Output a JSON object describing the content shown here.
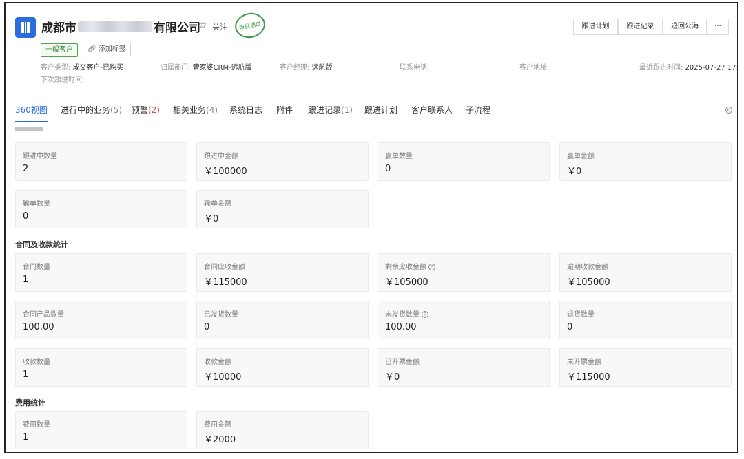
{
  "header": {
    "company_prefix": "成都市",
    "company_suffix": "有限公司",
    "follow_label": "关注",
    "stamp_text": "审批通过",
    "tag_type": "一般客户",
    "add_tag_label": "添加标签",
    "meta": {
      "customer_type_label": "客户类型:",
      "customer_type_value": "成交客户-已购买",
      "department_label": "归属部门:",
      "department_value": "管家婆CRM-远航版",
      "manager_label": "客户经理:",
      "manager_value": "远航版",
      "phone_label": "联系电话:",
      "address_label": "客户地址:",
      "last_follow_label": "最近跟进时间:",
      "last_follow_value": "2025-07-27 17:02",
      "next_follow_label": "下次跟进时间:"
    },
    "buttons": {
      "follow_plan": "跟进计划",
      "follow_record": "跟进记录",
      "return_pool": "退回公海",
      "more": "···"
    }
  },
  "tabs": [
    {
      "label": "360视图"
    },
    {
      "label": "进行中的业务",
      "count": "(5)"
    },
    {
      "label": "预警",
      "count": "(2)"
    },
    {
      "label": "相关业务",
      "count": "(4)"
    },
    {
      "label": "系统日志"
    },
    {
      "label": "附件"
    },
    {
      "label": "跟进记录",
      "count": "(1)"
    },
    {
      "label": "跟进计划"
    },
    {
      "label": "客户联系人"
    },
    {
      "label": "子流程"
    }
  ],
  "sections": {
    "contract_title": "合同及收款统计",
    "expense_title": "费用统计"
  },
  "cards": {
    "follow_count": {
      "label": "跟进中数量",
      "value": "2"
    },
    "follow_amount": {
      "label": "跟进中金额",
      "value": "￥100000"
    },
    "win_count": {
      "label": "赢单数量",
      "value": "0"
    },
    "win_amount": {
      "label": "赢单金额",
      "value": "￥0"
    },
    "lose_count": {
      "label": "输单数量",
      "value": "0"
    },
    "lose_amount": {
      "label": "输单金额",
      "value": "￥0"
    },
    "contract_count": {
      "label": "合同数量",
      "value": "1"
    },
    "contract_receivable": {
      "label": "合同应收金额",
      "value": "￥115000"
    },
    "remaining_receivable": {
      "label": "剩余应收金额",
      "value": "￥105000"
    },
    "overdue_amount": {
      "label": "逾期收款金额",
      "value": "￥105000"
    },
    "contract_product_count": {
      "label": "合同产品数量",
      "value": "100.00"
    },
    "shipped_count": {
      "label": "已发货数量",
      "value": "0"
    },
    "unshipped_count": {
      "label": "未发货数量",
      "value": "100.00"
    },
    "return_count": {
      "label": "退货数量",
      "value": "0"
    },
    "payment_count": {
      "label": "收款数量",
      "value": "1"
    },
    "payment_amount": {
      "label": "收款金额",
      "value": "￥10000"
    },
    "invoiced_amount": {
      "label": "已开票金额",
      "value": "￥0"
    },
    "uninvoiced_amount": {
      "label": "未开票金额",
      "value": "￥115000"
    },
    "expense_count": {
      "label": "费用数量",
      "value": "1"
    },
    "expense_amount": {
      "label": "费用金额",
      "value": "￥2000"
    }
  }
}
